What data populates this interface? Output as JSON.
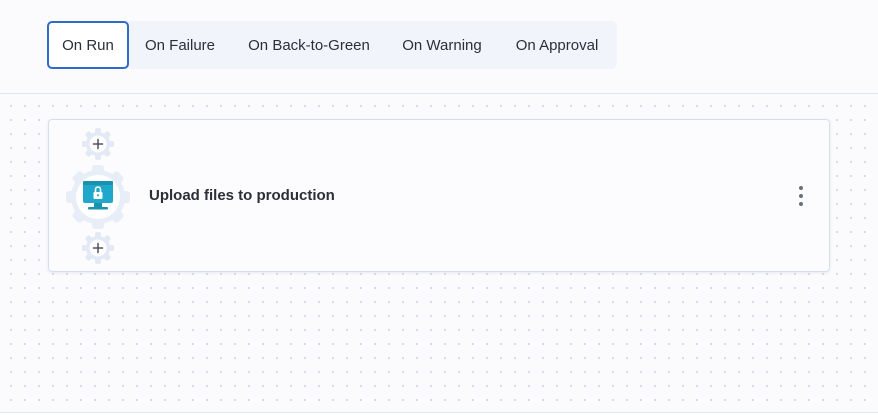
{
  "tabs": [
    {
      "label": "On Run",
      "active": true
    },
    {
      "label": "On Failure",
      "active": false
    },
    {
      "label": "On Back-to-Green",
      "active": false
    },
    {
      "label": "On Warning",
      "active": false
    },
    {
      "label": "On Approval",
      "active": false
    }
  ],
  "step": {
    "title": "Upload files to production",
    "icon": "sftp-upload-icon",
    "add_before_icon": "plus-icon",
    "add_after_icon": "plus-icon",
    "menu_icon": "kebab-menu-icon"
  },
  "colors": {
    "accent": "#2f6bc9",
    "icon_teal": "#1fa8c9",
    "gear_fill": "#e8eef8"
  }
}
